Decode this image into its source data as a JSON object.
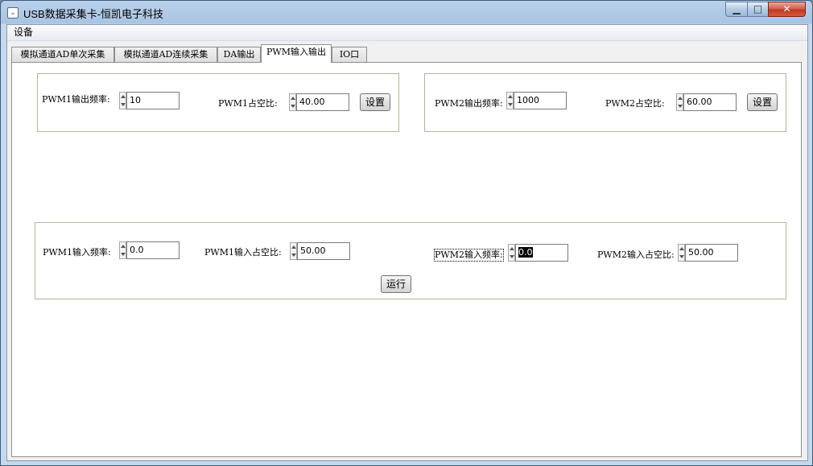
{
  "window": {
    "title": "USB数据采集卡-恒凯电子科技",
    "minimize_glyph": "▁",
    "maximize_glyph": "□",
    "close_glyph": "✕",
    "app_icon": "window-icon",
    "accent_close": "#c7402a",
    "frame_color": "#b9d1ea"
  },
  "menu": {
    "items": [
      {
        "label": "设备"
      }
    ]
  },
  "tabs": [
    {
      "label": "模拟通道AD单次采集",
      "active": false
    },
    {
      "label": "模拟通道AD连续采集",
      "active": false
    },
    {
      "label": "DA输出",
      "active": false
    },
    {
      "label": "PWM输入输出",
      "active": true
    },
    {
      "label": "IO口",
      "active": false
    }
  ],
  "pwm_output": {
    "pwm1": {
      "freq_label": "PWM1输出频率:",
      "freq_value": "10",
      "duty_label": "PWM1占空比:",
      "duty_value": "40.00",
      "set_button": "设置"
    },
    "pwm2": {
      "freq_label": "PWM2输出频率:",
      "freq_value": "1000",
      "duty_label": "PWM2占空比:",
      "duty_value": "60.00",
      "set_button": "设置"
    }
  },
  "pwm_input": {
    "pwm1_freq_label": "PWM1输入频率:",
    "pwm1_freq_value": "0.0",
    "pwm1_duty_label": "PWM1输入占空比:",
    "pwm1_duty_value": "50.00",
    "pwm2_freq_label": "PWM2输入频率:",
    "pwm2_freq_value": "0.0",
    "pwm2_duty_label": "PWM2输入占空比:",
    "pwm2_duty_value": "50.00",
    "run_button": "运行"
  }
}
